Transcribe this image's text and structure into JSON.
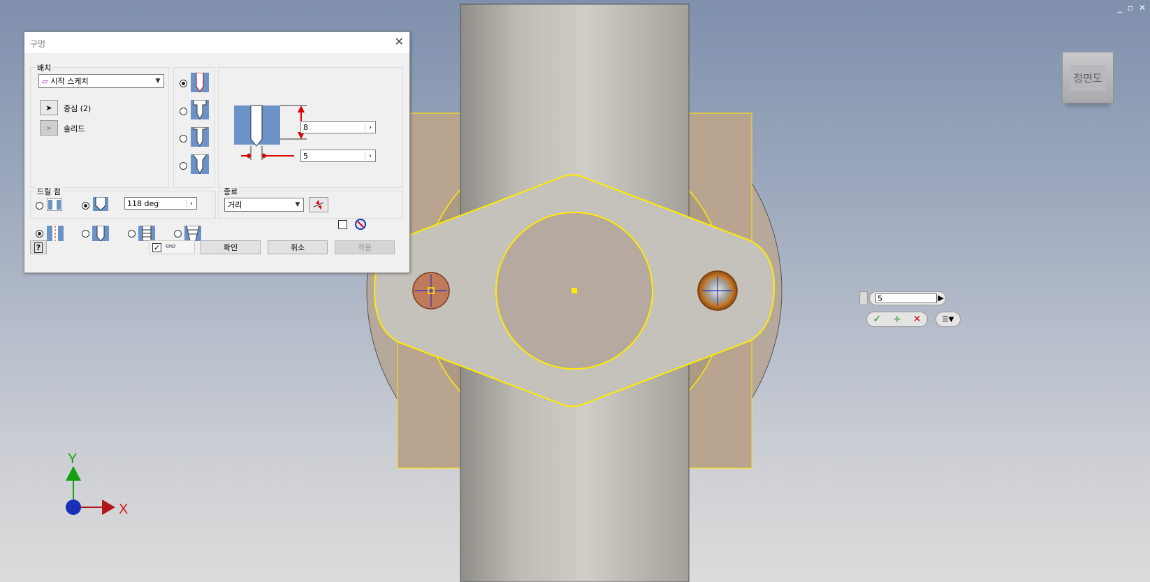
{
  "window_controls": {
    "minimize": "_",
    "restore": "▫",
    "close": "✕"
  },
  "viewcube": {
    "label": "정면도"
  },
  "axes": {
    "x": "X",
    "y": "Y"
  },
  "colors": {
    "sketch_yellow": "#ffeb00",
    "part_gray": "#c7c5bd",
    "axis_x": "#b0171a",
    "axis_y": "#14a014",
    "axis_origin": "#1a2fb8"
  },
  "dialog": {
    "title": "구멍",
    "placement": {
      "label": "배치",
      "type_select": "시작 스케치",
      "centers_label": "중심 (2)",
      "solid_label": "솔리드"
    },
    "depth_value": "8",
    "diameter_value": "5",
    "drill_point": {
      "label": "드릴 점",
      "angle": "118 deg"
    },
    "termination": {
      "label": "종료",
      "select": "거리"
    },
    "buttons": {
      "ok": "확인",
      "cancel": "취소",
      "apply": "적용",
      "help": "?"
    }
  },
  "mini_toolbar": {
    "value": "5"
  }
}
